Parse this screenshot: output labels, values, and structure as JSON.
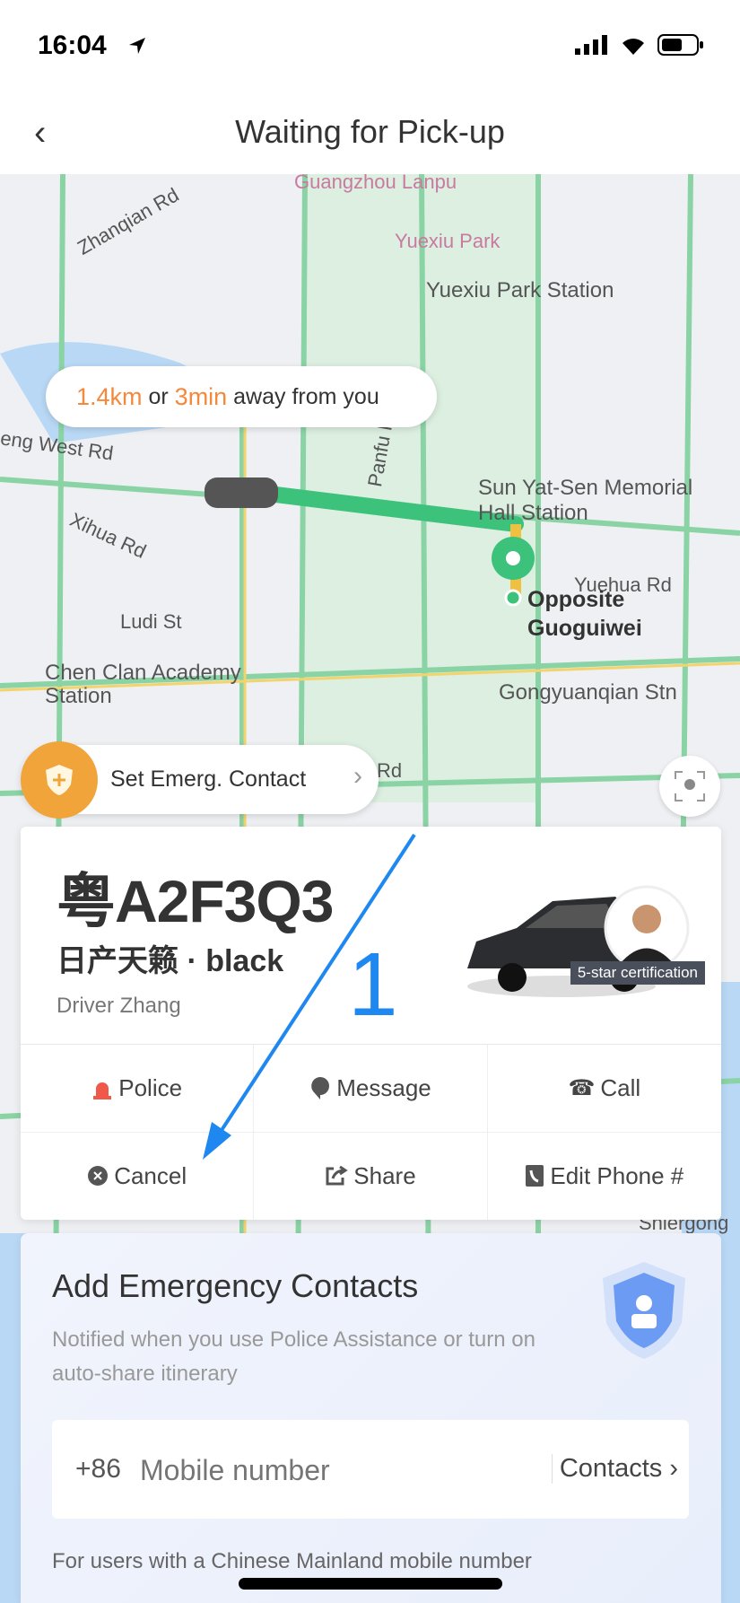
{
  "status_bar": {
    "time": "16:04"
  },
  "header": {
    "title": "Waiting for Pick-up",
    "back_icon": "chevron-left-icon"
  },
  "map": {
    "labels": [
      "Guangzhou Lanpu",
      "Zhanqian Rd",
      "Yuexiu Park",
      "Yuexiu Park Station",
      "eng West Rd",
      "Panfu Rd",
      "Sun Yat-Sen Memorial",
      "Hall Station",
      "Xihua Rd",
      "Yuehua Rd",
      "Opposite",
      "Guoguiwei",
      "Ludi St",
      "Chen Clan Academy",
      "Station",
      "Gongyuanqian Stn",
      "Rd",
      "Shiergong"
    ],
    "eta": {
      "distance": "1.4km",
      "or": "or",
      "time": "3min",
      "suffix": "away from you"
    },
    "route_color": "#3cc27a"
  },
  "emergency_pill": {
    "label": "Set Emerg. Contact"
  },
  "driver_card": {
    "plate": "粤A2F3Q3",
    "model": "日产天籁 · black",
    "driver": "Driver Zhang",
    "certification": "5-star certification",
    "actions": [
      {
        "label": "Police",
        "icon": "alarm-icon"
      },
      {
        "label": "Message",
        "icon": "message-icon"
      },
      {
        "label": "Call",
        "icon": "phone-icon"
      },
      {
        "label": "Cancel",
        "icon": "cancel-icon"
      },
      {
        "label": "Share",
        "icon": "share-icon"
      },
      {
        "label": "Edit Phone #",
        "icon": "edit-phone-icon"
      }
    ]
  },
  "annotation": {
    "number": "1",
    "color": "#1e88f0"
  },
  "emergency_contacts": {
    "title": "Add Emergency Contacts",
    "subtitle": "Notified when you use Police Assistance or turn on auto-share itinerary",
    "country_code": "+86",
    "phone_placeholder": "Mobile number",
    "contacts_label": "Contacts",
    "note": "For users with a Chinese Mainland mobile number"
  }
}
